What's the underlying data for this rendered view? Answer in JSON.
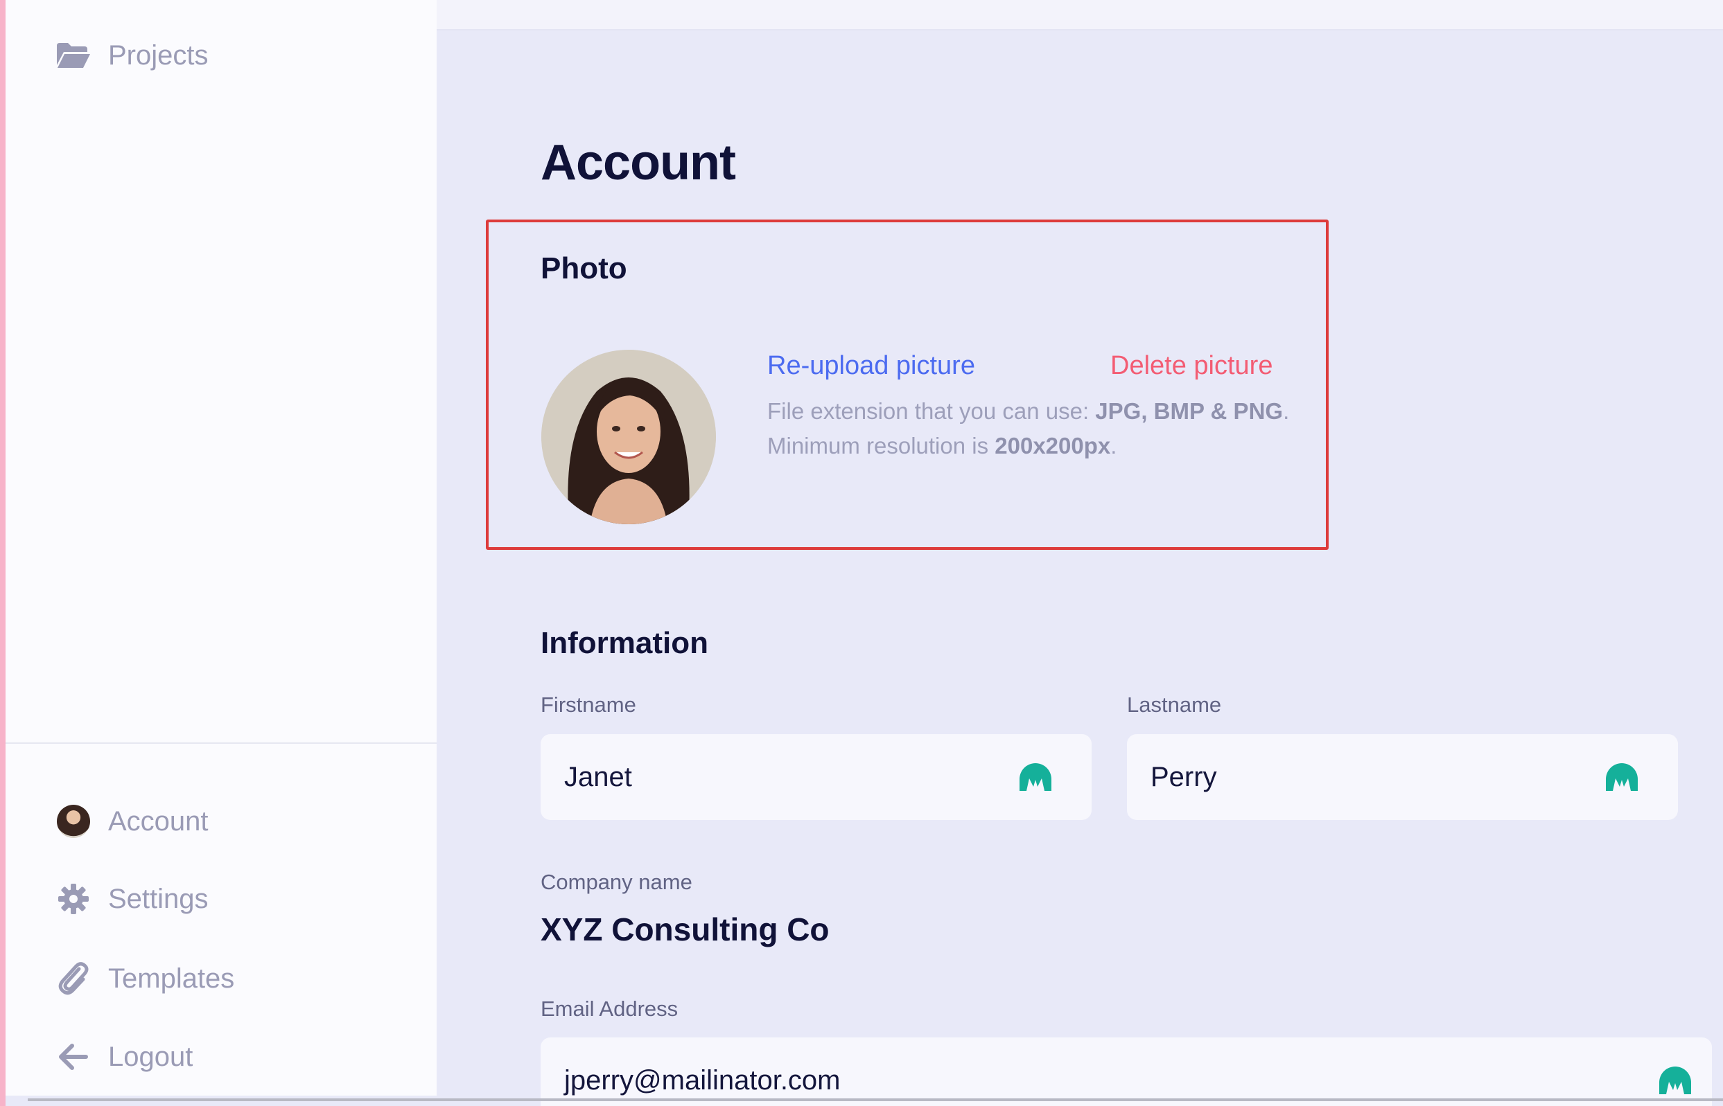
{
  "sidebar": {
    "top_items": [
      {
        "label": "Projects",
        "icon": "folder-open-icon"
      }
    ],
    "bottom_items": [
      {
        "label": "Account",
        "icon": "avatar"
      },
      {
        "label": "Settings",
        "icon": "gear-icon"
      },
      {
        "label": "Templates",
        "icon": "paperclip-icon"
      },
      {
        "label": "Logout",
        "icon": "arrow-left-icon"
      }
    ]
  },
  "main": {
    "title": "Account",
    "photo": {
      "title": "Photo",
      "reupload_label": "Re-upload picture",
      "delete_label": "Delete picture",
      "hint_line1_prefix": "File extension that you can use: ",
      "hint_line1_bold": "JPG, BMP & PNG",
      "hint_line1_suffix": ".",
      "hint_line2_prefix": "Minimum resolution is ",
      "hint_line2_bold": "200x200px",
      "hint_line2_suffix": "."
    },
    "information": {
      "title": "Information",
      "firstname_label": "Firstname",
      "firstname_value": "Janet",
      "lastname_label": "Lastname",
      "lastname_value": "Perry",
      "company_label": "Company name",
      "company_value": "XYZ Consulting Co",
      "email_label": "Email Address",
      "email_value": "jperry@mailinator.com"
    }
  },
  "colors": {
    "accent_blue": "#4c6bf0",
    "danger_pink": "#f35c73",
    "highlight_border": "#dd3b3b",
    "check_teal": "#15b09a"
  }
}
